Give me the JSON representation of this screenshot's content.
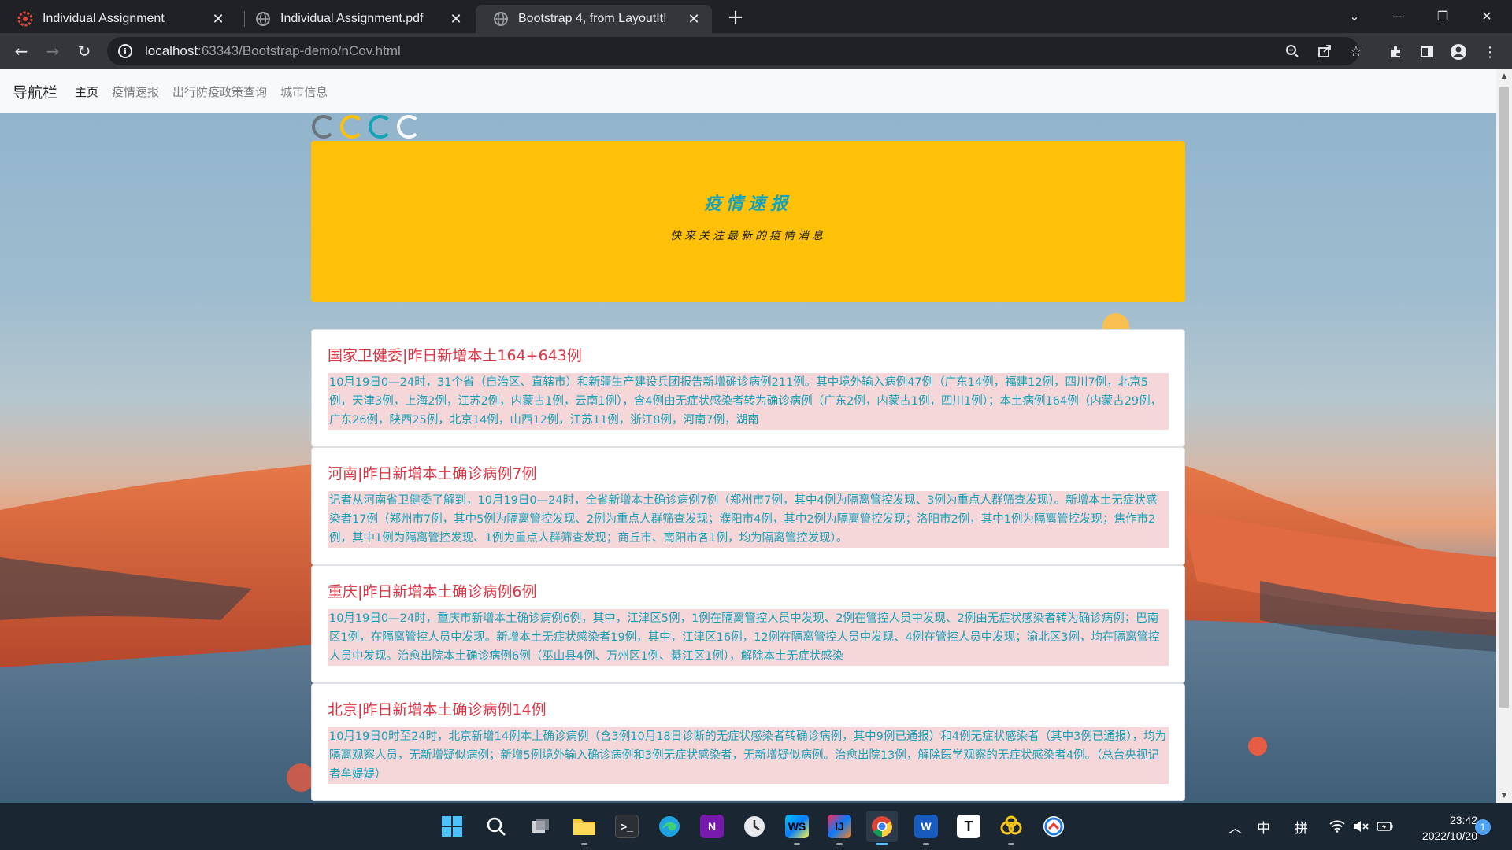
{
  "browser": {
    "tabs": [
      {
        "title": "Individual Assignment",
        "favicon": "gear-favicon",
        "active": false
      },
      {
        "title": "Individual Assignment.pdf",
        "favicon": "globe-favicon",
        "active": false
      },
      {
        "title": "Bootstrap 4, from LayoutIt!",
        "favicon": "globe-favicon",
        "active": true
      }
    ],
    "new_tab_label": "+",
    "url_host": "localhost",
    "url_rest": ":63343/Bootstrap-demo/nCov.html"
  },
  "page": {
    "navbar": {
      "brand": "导航栏",
      "links": [
        "主页",
        "疫情速报",
        "出行防疫政策查询",
        "城市信息"
      ]
    },
    "jumbotron": {
      "title": "疫情速报",
      "subtitle": "快来关注最新的疫情消息"
    },
    "news": [
      {
        "title": "国家卫健委|昨日新增本土164+643例",
        "text": "10月19日0—24时，31个省（自治区、直辖市）和新疆生产建设兵团报告新增确诊病例211例。其中境外输入病例47例（广东14例，福建12例，四川7例，北京5例，天津3例，上海2例，江苏2例，内蒙古1例，云南1例），含4例由无症状感染者转为确诊病例（广东2例，内蒙古1例，四川1例）；本土病例164例（内蒙古29例，广东26例，陕西25例，北京14例，山西12例，江苏11例，浙江8例，河南7例，湖南"
      },
      {
        "title": "河南|昨日新增本土确诊病例7例",
        "text": "记者从河南省卫健委了解到，10月19日0—24时，全省新增本土确诊病例7例（郑州市7例，其中4例为隔离管控发现、3例为重点人群筛查发现）。新增本土无症状感染者17例（郑州市7例，其中5例为隔离管控发现、2例为重点人群筛查发现；濮阳市4例，其中2例为隔离管控发现；洛阳市2例，其中1例为隔离管控发现；焦作市2例，其中1例为隔离管控发现、1例为重点人群筛查发现；商丘市、南阳市各1例，均为隔离管控发现）。"
      },
      {
        "title": "重庆|昨日新增本土确诊病例6例",
        "text": "10月19日0—24时，重庆市新增本土确诊病例6例，其中，江津区5例，1例在隔离管控人员中发现、2例在管控人员中发现、2例由无症状感染者转为确诊病例；巴南区1例，在隔离管控人员中发现。新增本土无症状感染者19例，其中，江津区16例，12例在隔离管控人员中发现、4例在管控人员中发现；渝北区3例，均在隔离管控人员中发现。治愈出院本土确诊病例6例（巫山县4例、万州区1例、綦江区1例），解除本土无症状感染"
      },
      {
        "title": "北京|昨日新增本土确诊病例14例",
        "text": "10月19日0时至24时，北京新增14例本土确诊病例（含3例10月18日诊断的无症状感染者转确诊病例，其中9例已通报）和4例无症状感染者（其中3例已通报），均为隔离观察人员，无新增疑似病例；新增5例境外输入确诊病例和3例无症状感染者，无新增疑似病例。治愈出院13例，解除医学观察的无症状感染者4例。（总台央视记者牟媞媞）"
      }
    ]
  },
  "taskbar": {
    "apps": [
      "windows-start",
      "search",
      "task-view",
      "file-explorer",
      "terminal",
      "edge",
      "onenote",
      "clock-app",
      "webstorm",
      "intellij",
      "chrome",
      "word",
      "typora",
      "baidu-netdisk",
      "speedtest"
    ],
    "tray": {
      "ime_lang": "中",
      "ime_mode": "拼",
      "time": "23:42",
      "date": "2022/10/20",
      "notifications": "1"
    }
  },
  "colors": {
    "jumbotron_bg": "#ffc107",
    "card_title": "#dc3545",
    "card_text": "#17a2b8",
    "card_text_bg": "#f5d6d9"
  }
}
